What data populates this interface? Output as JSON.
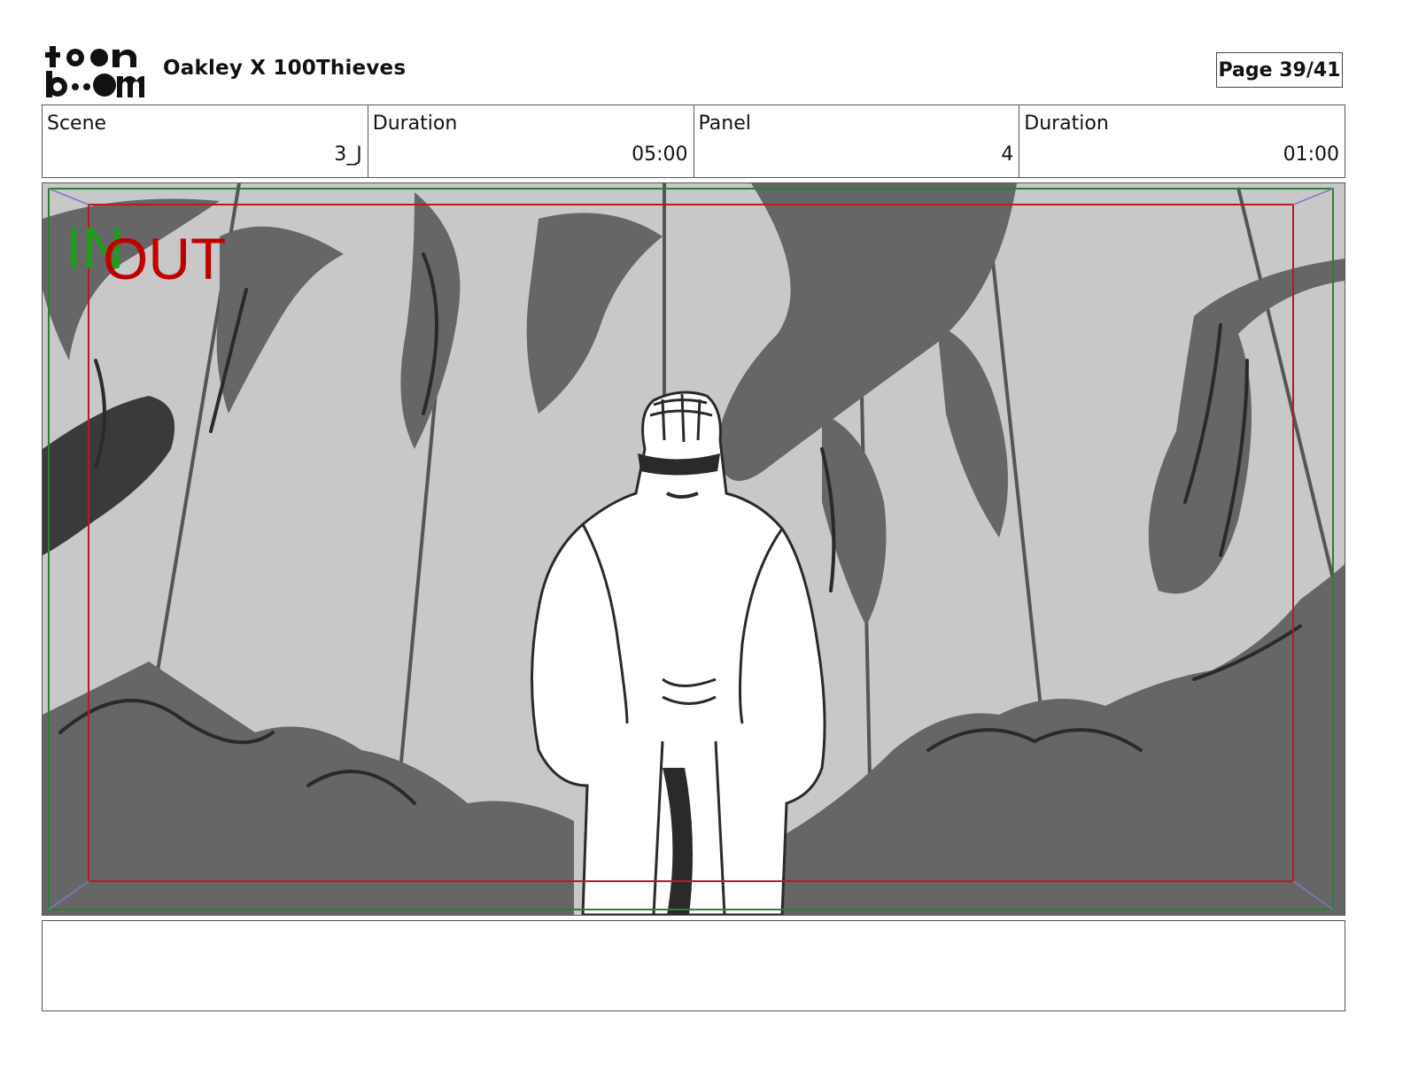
{
  "header": {
    "logo_text": [
      "toon",
      "boom"
    ],
    "project_title": "Oakley X 100Thieves",
    "page_indicator": "Page 39/41"
  },
  "info": {
    "scene_label": "Scene",
    "scene_value": "3_J",
    "scene_duration_label": "Duration",
    "scene_duration_value": "05:00",
    "panel_label": "Panel",
    "panel_value": "4",
    "panel_duration_label": "Duration",
    "panel_duration_value": "01:00"
  },
  "panel": {
    "in_label": "IN",
    "out_label": "OUT",
    "colors": {
      "safe_frame": "#2e7d32",
      "action_frame": "#b71c1c",
      "in_text": "#1aa01a",
      "out_text": "#c00000",
      "sky": "#c8c8c8",
      "foliage": "#666666",
      "dark": "#3a3a3a"
    }
  },
  "notes": {
    "text": ""
  }
}
